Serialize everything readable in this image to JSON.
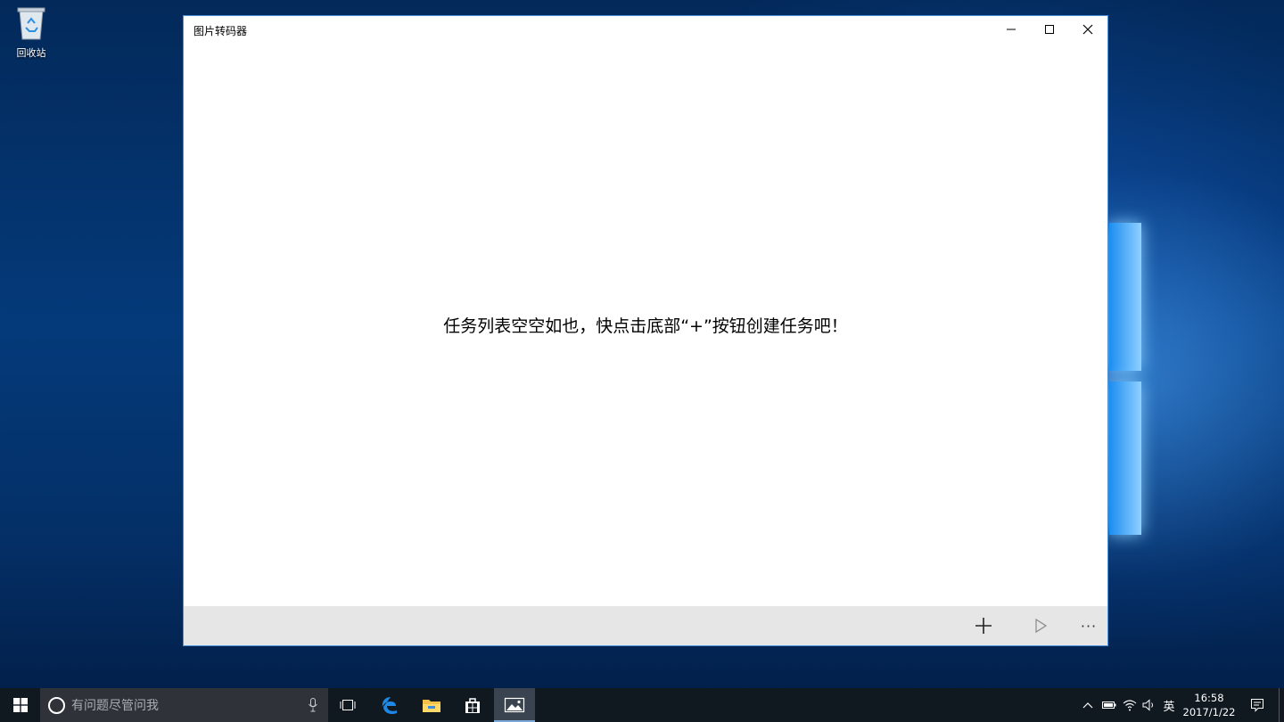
{
  "desktop": {
    "recycle_bin_label": "回收站"
  },
  "window": {
    "title": "图片转码器",
    "controls": {
      "minimize": "minimize-icon",
      "maximize": "maximize-icon",
      "close": "close-icon"
    },
    "empty_message": "任务列表空空如也，快点击底部“+”按钮创建任务吧！",
    "appbar": {
      "add_icon": "plus-icon",
      "play_icon": "play-icon",
      "more_label": "···"
    }
  },
  "taskbar": {
    "search_placeholder": "有问题尽管问我",
    "ime_label": "英",
    "time": "16:58",
    "date": "2017/1/22",
    "pinned": [
      "task-view-icon",
      "edge-icon",
      "file-explorer-icon",
      "store-icon",
      "photo-app-icon"
    ]
  },
  "colors": {
    "window_border": "#4a90d9",
    "appbar_bg": "#e6e6e6",
    "taskbar_bg": "#101820"
  }
}
